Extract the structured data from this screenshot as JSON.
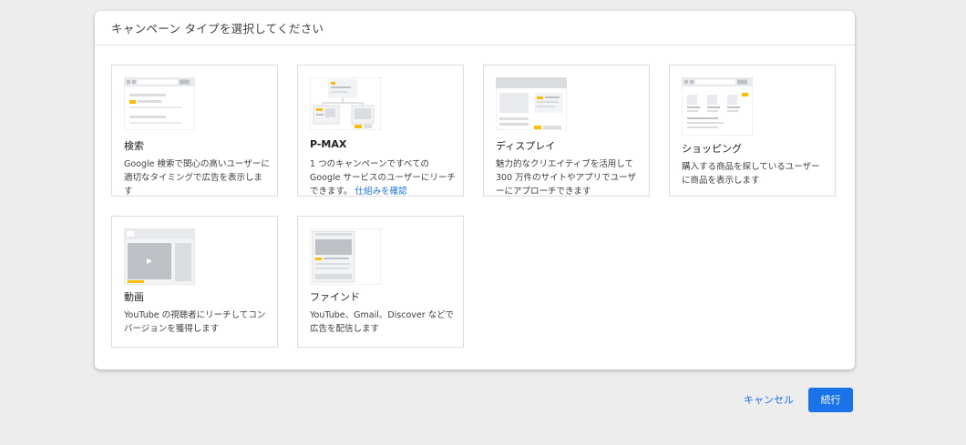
{
  "dialog": {
    "title": "キャンペーン タイプを選択してください"
  },
  "cards": [
    {
      "title": "検索",
      "description": "Google 検索で関心の高いユーザーに適切なタイミングで広告を表示します"
    },
    {
      "title": "P-MAX",
      "description": "1 つのキャンペーンですべての Google サービスのユーザーにリーチできます。",
      "link": "仕組みを確認"
    },
    {
      "title": "ディスプレイ",
      "description": "魅力的なクリエイティブを活用して 300 万件のサイトやアプリでユーザーにアプローチできます"
    },
    {
      "title": "ショッピング",
      "description": "購入する商品を探しているユーザーに商品を表示します"
    },
    {
      "title": "動画",
      "description": "YouTube の視聴者にリーチしてコンバージョンを獲得します"
    },
    {
      "title": "ファインド",
      "description": "YouTube、Gmail、Discover などで広告を配信します"
    }
  ],
  "footer": {
    "cancel_label": "キャンセル",
    "continue_label": "続行"
  },
  "colors": {
    "accent": "#1a73e8",
    "thumb_highlight": "#fbbc04",
    "thumb_gray": "#dadce0"
  }
}
